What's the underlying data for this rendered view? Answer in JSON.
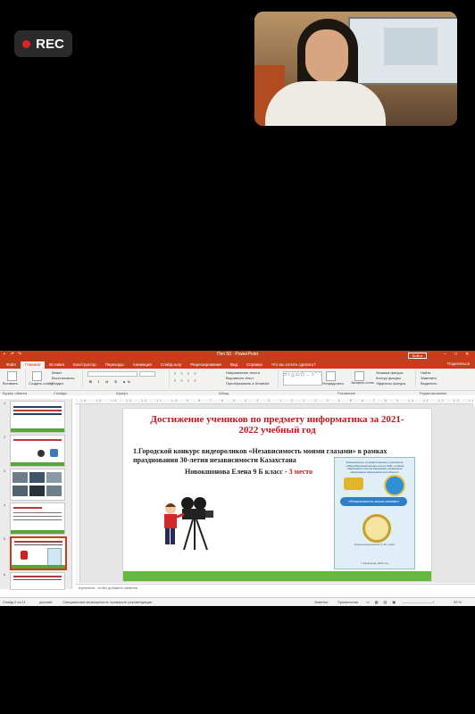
{
  "recording": {
    "label": "REC"
  },
  "app": {
    "title": "Ппп 50 - PowerPoint",
    "signin": "Войти",
    "share": "Поделиться"
  },
  "tabs": [
    "Файл",
    "Главная",
    "Вставка",
    "Конструктор",
    "Переходы",
    "Анимация",
    "Слайд-шоу",
    "Рецензирование",
    "Вид",
    "Справка",
    "Что вы хотите сделать?"
  ],
  "ribbon": {
    "paste": "Вставить",
    "new_slide": "Создать слайд",
    "layout": "Макет",
    "reset": "Восстановить",
    "section": "Раздел",
    "text_direction": "Направление текста",
    "align_text": "Выровнять текст",
    "smartart": "Преобразовать в SmartArt",
    "arrange": "Упорядочить",
    "quick_styles": "Экспресс-стили",
    "shape_fill": "Заливка фигуры",
    "shape_outline": "Контур фигуры",
    "shape_effects": "Эффекты фигуры",
    "find": "Найти",
    "replace": "Заменить",
    "select": "Выделить",
    "groups": {
      "clipboard": "Буфер обмена",
      "slides": "Слайды",
      "font": "Шрифт",
      "paragraph": "Абзац",
      "drawing": "Рисование",
      "editing": "Редактирование"
    }
  },
  "thumbnails": [
    {
      "num": "1",
      "title": "Муниципальное государственное учреждение «Конкурс видеороликов»"
    },
    {
      "num": "2",
      "title": "Итоговая информация"
    },
    {
      "num": "3",
      "title": ""
    },
    {
      "num": "4",
      "title": "Достижения учащихся"
    },
    {
      "num": "5",
      "title": "Достижение учеников по предмету информатика"
    },
    {
      "num": "6",
      "title": "Достижение учеников по предмету информатика"
    }
  ],
  "slide": {
    "title": "Достижение учеников по предмету информатика за 2021-2022 учебный год",
    "body": "1.Городской конкурс видеороликов «Независимость моими глазами» в рамках празднования 30-летия независимости Казахстана",
    "student": "Новокшонова Елена 9 Б класс - ",
    "place": "3 место",
    "certificate": {
      "header": "Коммунальное государственное учреждение «Общеобразовательная школа №30» отдела образования города Караганды управления образования Карагандинской области",
      "banner": "«Независимость моими глазами»",
      "recipient": "Новокшонова Елена 9 «Б» класс",
      "date": "г. Караганда, 2021 год"
    }
  },
  "notes": {
    "placeholder": "Щелкните, чтобы добавить заметки"
  },
  "status": {
    "slide_info": "Слайд 5 из 11",
    "language": "русский",
    "accessibility": "Специальные возможности: проверьте рекомендации",
    "notes_btn": "Заметки",
    "comments_btn": "Примечания",
    "zoom": "53 %"
  }
}
